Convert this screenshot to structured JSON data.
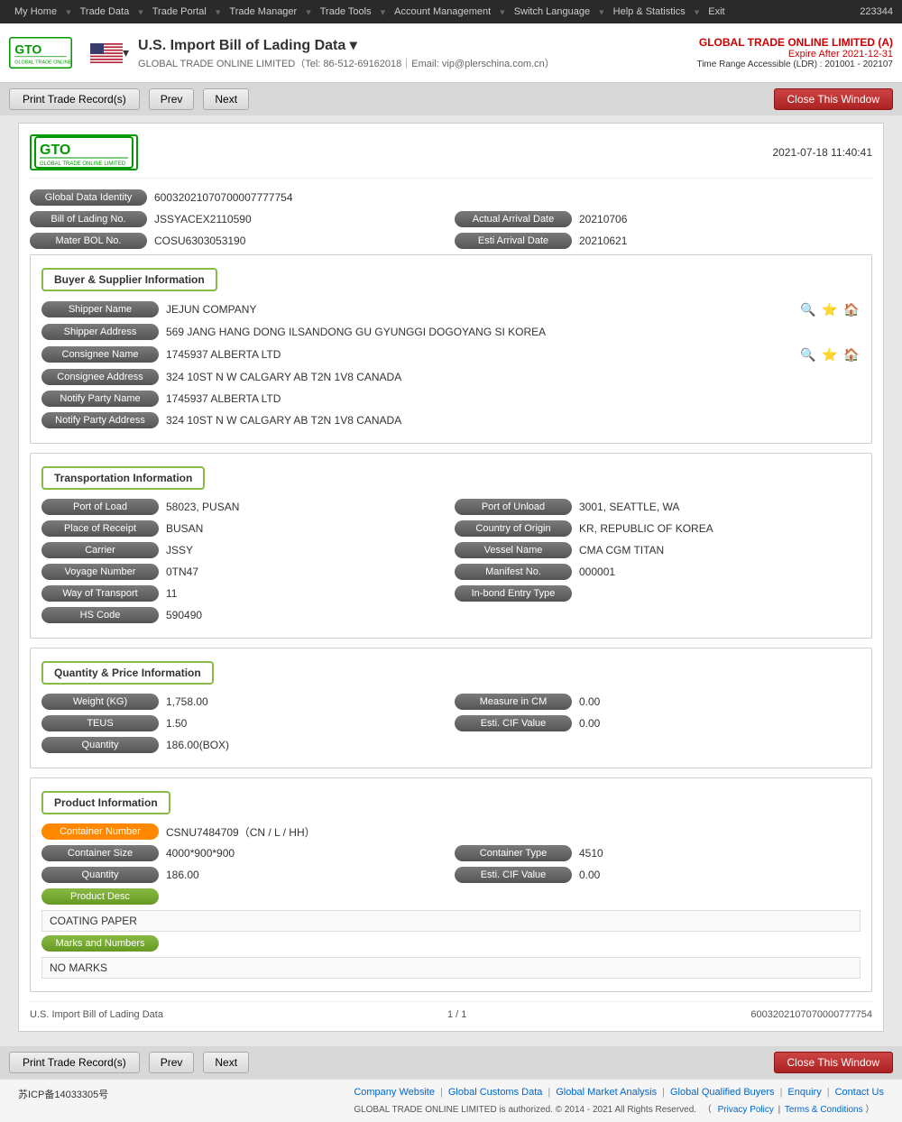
{
  "topnav": {
    "items": [
      "My Home",
      "Trade Data",
      "Trade Portal",
      "Trade Manager",
      "Trade Tools",
      "Account Management",
      "Switch Language",
      "Help & Statistics",
      "Exit"
    ],
    "user_id": "223344"
  },
  "header": {
    "page_title": "U.S. Import Bill of Lading Data ▾",
    "subtitle": "GLOBAL TRADE ONLINE LIMITED（Tel: 86-512-69162018｜Email: vip@plerschina.com.cn）",
    "company_name": "GLOBAL TRADE ONLINE LIMITED (A)",
    "expire_label": "Expire After 2021-12-31",
    "time_range": "Time Range Accessible (LDR) : 201001 - 202107"
  },
  "toolbar": {
    "print_label": "Print Trade Record(s)",
    "prev_label": "Prev",
    "next_label": "Next",
    "close_label": "Close This Window"
  },
  "record": {
    "datetime": "2021-07-18 11:40:41",
    "global_data_id_label": "Global Data Identity",
    "global_data_id_value": "60032021070700007777754",
    "bol_no_label": "Bill of Lading No.",
    "bol_no_value": "JSSYACEX2110590",
    "actual_arrival_label": "Actual Arrival Date",
    "actual_arrival_value": "20210706",
    "mater_bol_label": "Mater BOL No.",
    "mater_bol_value": "COSU6303053190",
    "esti_arrival_label": "Esti Arrival Date",
    "esti_arrival_value": "20210621",
    "buyer_supplier_section": "Buyer & Supplier Information",
    "shipper_name_label": "Shipper Name",
    "shipper_name_value": "JEJUN COMPANY",
    "shipper_address_label": "Shipper Address",
    "shipper_address_value": "569 JANG HANG DONG ILSANDONG GU GYUNGGI DOGOYANG SI KOREA",
    "consignee_name_label": "Consignee Name",
    "consignee_name_value": "1745937 ALBERTA LTD",
    "consignee_address_label": "Consignee Address",
    "consignee_address_value": "324 10ST N W CALGARY AB T2N 1V8 CANADA",
    "notify_party_name_label": "Notify Party Name",
    "notify_party_name_value": "1745937 ALBERTA LTD",
    "notify_party_address_label": "Notify Party Address",
    "notify_party_address_value": "324 10ST N W CALGARY AB T2N 1V8 CANADA",
    "transport_section": "Transportation Information",
    "port_of_load_label": "Port of Load",
    "port_of_load_value": "58023, PUSAN",
    "port_of_unload_label": "Port of Unload",
    "port_of_unload_value": "3001, SEATTLE, WA",
    "place_of_receipt_label": "Place of Receipt",
    "place_of_receipt_value": "BUSAN",
    "country_of_origin_label": "Country of Origin",
    "country_of_origin_value": "KR, REPUBLIC OF KOREA",
    "carrier_label": "Carrier",
    "carrier_value": "JSSY",
    "vessel_name_label": "Vessel Name",
    "vessel_name_value": "CMA CGM TITAN",
    "voyage_number_label": "Voyage Number",
    "voyage_number_value": "0TN47",
    "manifest_no_label": "Manifest No.",
    "manifest_no_value": "000001",
    "way_of_transport_label": "Way of Transport",
    "way_of_transport_value": "11",
    "in_bond_label": "In-bond Entry Type",
    "in_bond_value": "",
    "hs_code_label": "HS Code",
    "hs_code_value": "590490",
    "qty_section": "Quantity & Price Information",
    "weight_kg_label": "Weight (KG)",
    "weight_kg_value": "1,758.00",
    "measure_cm_label": "Measure in CM",
    "measure_cm_value": "0.00",
    "teus_label": "TEUS",
    "teus_value": "1.50",
    "esti_cif_label": "Esti. CIF Value",
    "esti_cif_value": "0.00",
    "quantity_label": "Quantity",
    "quantity_value": "186.00(BOX)",
    "product_section": "Product Information",
    "container_number_label": "Container Number",
    "container_number_value": "CSNU7484709（CN / L / HH）",
    "container_size_label": "Container Size",
    "container_size_value": "4000*900*900",
    "container_type_label": "Container Type",
    "container_type_value": "4510",
    "qty2_label": "Quantity",
    "qty2_value": "186.00",
    "esti_cif2_label": "Esti. CIF Value",
    "esti_cif2_value": "0.00",
    "product_desc_label": "Product Desc",
    "product_desc_value": "COATING PAPER",
    "marks_numbers_label": "Marks and Numbers",
    "marks_numbers_value": "NO MARKS",
    "footer_title": "U.S. Import Bill of Lading Data",
    "footer_page": "1 / 1",
    "footer_id": "6003202107070000777754"
  },
  "footer": {
    "icp": "苏ICP备14033305号",
    "links": [
      "Company Website",
      "Global Customs Data",
      "Global Market Analysis",
      "Global Qualified Buyers",
      "Enquiry",
      "Contact Us"
    ],
    "copyright": "GLOBAL TRADE ONLINE LIMITED is authorized. © 2014 - 2021 All Rights Reserved.",
    "privacy": "Privacy Policy",
    "terms": "Terms & Conditions"
  }
}
